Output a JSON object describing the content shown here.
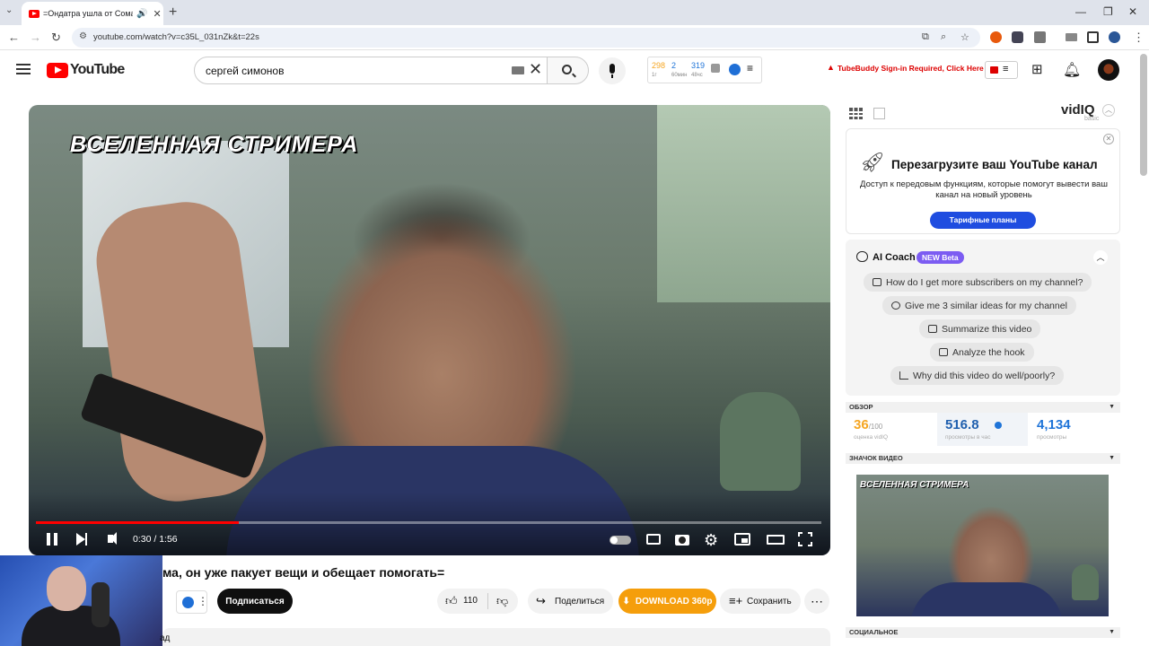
{
  "browser": {
    "tab_title": "=Ондатра ушла от Сома,",
    "url": "youtube.com/watch?v=c35L_031nZk&t=22s"
  },
  "header": {
    "logo_text": "YouTube",
    "search_value": "сергей симонов",
    "vidiq_stats": [
      {
        "value": "298",
        "label": "1г",
        "color": "#f5a623"
      },
      {
        "value": "2",
        "label": "60мин",
        "color": "#1f74d8"
      },
      {
        "value": "319",
        "label": "48чс",
        "color": "#1f74d8"
      }
    ],
    "tubebuddy_notice": "TubeBuddy Sign-in Required, Click Here"
  },
  "player": {
    "watermark": "ВСЕЛЕННАЯ СТРИМЕРА",
    "time_current": "0:30",
    "time_total": "1:56",
    "time_display": "0:30 / 1:56",
    "progress": 0.258
  },
  "video": {
    "title": "ма, он уже пакует вещи и обещает помогать=",
    "subscribe_label": "Подписаться",
    "likes": "110",
    "share_label": "Поделиться",
    "download_label": "DOWNLOAD 360p",
    "save_label": "Сохранить",
    "description_peek": "ад"
  },
  "vidiq": {
    "logo": "vidIQ",
    "plan": "basic",
    "promo": {
      "title": "Перезагрузите ваш YouTube канал",
      "description": "Доступ к передовым функциям, которые помогут вывести ваш канал на новый уровень",
      "button": "Тарифные планы"
    },
    "coach": {
      "title": "AI Coach",
      "badge": "NEW Beta",
      "questions": [
        "How do I get more subscribers on my channel?",
        "Give me 3 similar ideas for my channel",
        "Summarize this video",
        "Analyze the hook",
        "Why did this video do well/poorly?"
      ]
    },
    "overview": {
      "header": "ОБЗОР",
      "score": "36",
      "score_max": "/100",
      "score_label": "оценка vidIQ",
      "vph": "516.8",
      "vph_label": "просмотры в час",
      "views": "4,134",
      "views_label": "просмотры"
    },
    "thumbnail_header": "ЗНАЧОК ВИДЕО",
    "thumbnail_watermark": "ВСЕЛЕННАЯ СТРИМЕРА",
    "social_header": "СОЦИАЛЬНОЕ"
  },
  "colors": {
    "youtube_red": "#ff0000",
    "vidiq_blue": "#1f74d8",
    "score_orange": "#f5a623",
    "download_orange": "#f59e0b",
    "coach_purple": "#7c5cf2"
  }
}
